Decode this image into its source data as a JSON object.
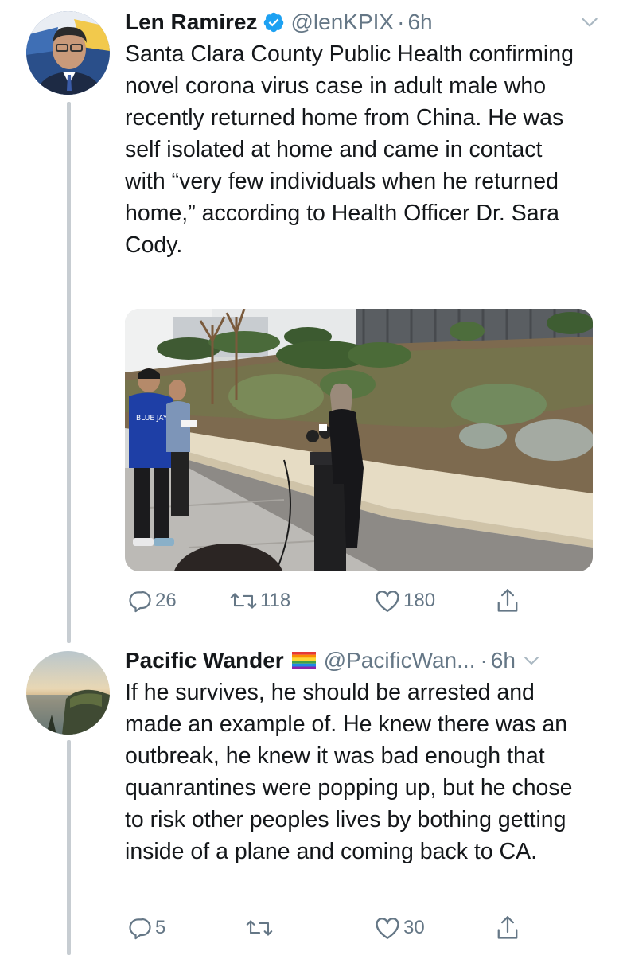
{
  "tweets": [
    {
      "author": "Len Ramirez",
      "handle": "@lenKPIX",
      "time": "6h",
      "text": "Santa Clara County Public Health confirming novel corona virus case in adult male who recently returned home from China.  He was self isolated at home and came in contact with “very few individuals when he returned home,” according to Health Officer Dr. Sara Cody.",
      "replies": "26",
      "retweets": "118",
      "likes": "180"
    },
    {
      "author": "Pacific Wander",
      "handle": "@PacificWan...",
      "time": "6h",
      "text": "If he survives, he should be arrested and made an example of. He knew there was an outbreak, he knew it was bad enough that quanrantines were popping up, but he chose to risk other peoples lives by bothing getting inside of a plane and coming back to CA.",
      "replies": "5",
      "retweets": "",
      "likes": "30"
    }
  ],
  "separator": "·",
  "colors": {
    "verified": "#1da1f2",
    "meta": "#657786",
    "thread": "#c7cdd2"
  },
  "icons": [
    "verified-badge-icon",
    "chevron-down-icon",
    "reply-icon",
    "retweet-icon",
    "like-icon",
    "share-icon",
    "rainbow-flag-icon"
  ]
}
